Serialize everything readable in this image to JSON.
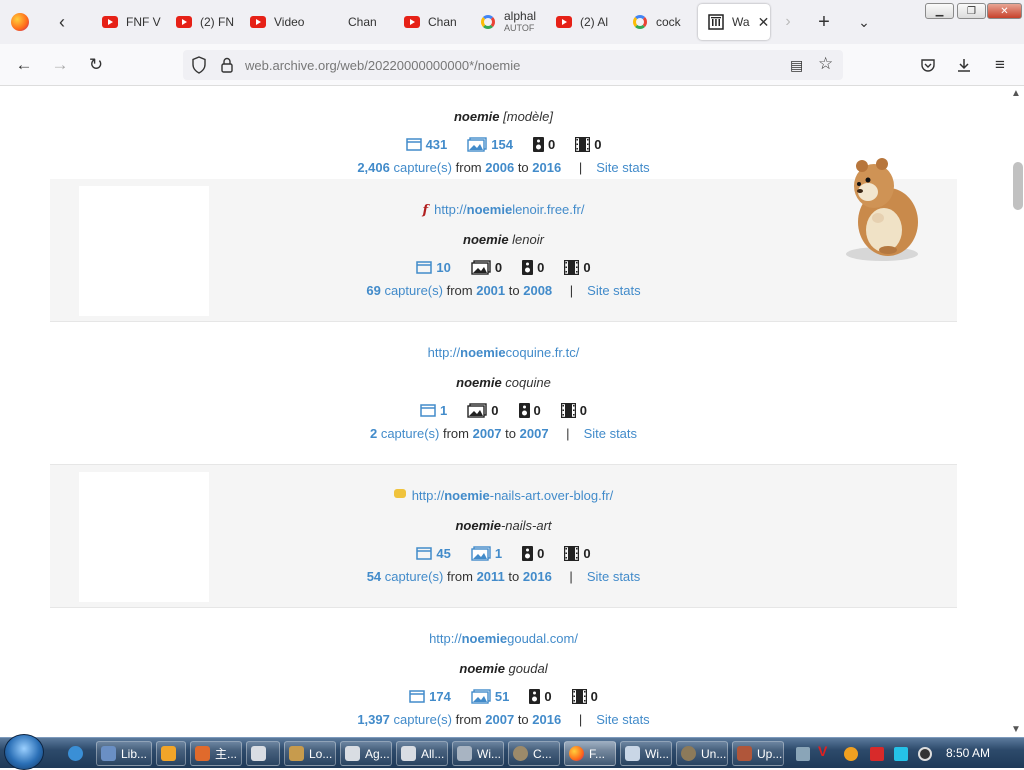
{
  "browser": {
    "tabs": [
      {
        "label": "FNF V",
        "icon": "youtube-icon"
      },
      {
        "label": "(2) FN",
        "icon": "youtube-icon"
      },
      {
        "label": "Video",
        "icon": "youtube-icon"
      },
      {
        "label": "Chan",
        "icon": "youtube-icon"
      },
      {
        "label": "Chan",
        "icon": "youtube-icon"
      },
      {
        "label": "alphal",
        "sub": "AUTOF",
        "icon": "google-icon"
      },
      {
        "label": "(2) Al",
        "icon": "youtube-icon"
      },
      {
        "label": "cock",
        "icon": "google-icon"
      },
      {
        "label": "Wa",
        "icon": "archive-icon",
        "active": true
      }
    ],
    "url_host": "web.archive.org",
    "url_path": "/web/20220000000000*/noemie"
  },
  "results": [
    {
      "url_prefix": "",
      "url_bold": "",
      "url_suffix": "",
      "title_bold": "noemie",
      "title_rest": "[modèle]",
      "html_count": "431",
      "image_count": "154",
      "audio_count": "0",
      "video_count": "0",
      "captures": "2,406",
      "captures_label": "capture(s)",
      "from_label": "from",
      "from_year": "2006",
      "to_label": "to",
      "to_year": "2016",
      "site_stats": "Site stats"
    },
    {
      "url_prefix": "http://",
      "url_bold": "noemie",
      "url_suffix": "lenoir.free.fr/",
      "favicon": "flash-icon",
      "title_bold": "noemie",
      "title_rest": "lenoir",
      "html_count": "10",
      "image_count": "0",
      "audio_count": "0",
      "video_count": "0",
      "captures": "69",
      "captures_label": "capture(s)",
      "from_label": "from",
      "from_year": "2001",
      "to_label": "to",
      "to_year": "2008",
      "site_stats": "Site stats"
    },
    {
      "url_prefix": "http://",
      "url_bold": "noemie",
      "url_suffix": "coquine.fr.tc/",
      "title_bold": "noemie",
      "title_rest": "coquine",
      "html_count": "1",
      "image_count": "0",
      "audio_count": "0",
      "video_count": "0",
      "captures": "2",
      "captures_label": "capture(s)",
      "from_label": "from",
      "from_year": "2007",
      "to_label": "to",
      "to_year": "2007",
      "site_stats": "Site stats"
    },
    {
      "url_prefix": "http://",
      "url_bold": "noemie",
      "url_suffix": "-nails-art.over-blog.fr/",
      "favicon": "comment-icon",
      "title_bold": "noemie",
      "title_rest": "-nails-art",
      "html_count": "45",
      "image_count": "1",
      "audio_count": "0",
      "video_count": "0",
      "captures": "54",
      "captures_label": "capture(s)",
      "from_label": "from",
      "from_year": "2011",
      "to_label": "to",
      "to_year": "2016",
      "site_stats": "Site stats"
    },
    {
      "url_prefix": "http://",
      "url_bold": "noemie",
      "url_suffix": "goudal.com/",
      "title_bold": "noemie",
      "title_rest": "goudal",
      "html_count": "174",
      "image_count": "51",
      "audio_count": "0",
      "video_count": "0",
      "captures": "1,397",
      "captures_label": "capture(s)",
      "from_label": "from",
      "from_year": "2007",
      "to_label": "to",
      "to_year": "2016",
      "site_stats": "Site stats"
    }
  ],
  "taskbar": {
    "items": [
      {
        "label": "Lib...",
        "icon": "library-icon"
      },
      {
        "label": "",
        "icon": "media-player-icon"
      },
      {
        "label": "主...",
        "icon": "chinese-app-icon"
      },
      {
        "label": "",
        "icon": "window-icon"
      },
      {
        "label": "Lo...",
        "icon": "folder-icon"
      },
      {
        "label": "Ag...",
        "icon": "window-icon"
      },
      {
        "label": "All...",
        "icon": "window-icon"
      },
      {
        "label": "Wi...",
        "icon": "keyboard-icon"
      },
      {
        "label": "C...",
        "icon": "app-icon"
      },
      {
        "label": "F...",
        "icon": "firefox-icon",
        "active": true
      },
      {
        "label": "Wi...",
        "icon": "notepad-icon"
      },
      {
        "label": "Un...",
        "icon": "app-icon"
      },
      {
        "label": "Up...",
        "icon": "app-icon"
      }
    ],
    "clock": "8:50 AM"
  },
  "colors": {
    "link": "#428bca",
    "row_shade": "#f5f5f5",
    "taskbar": "#2d4a6b"
  }
}
